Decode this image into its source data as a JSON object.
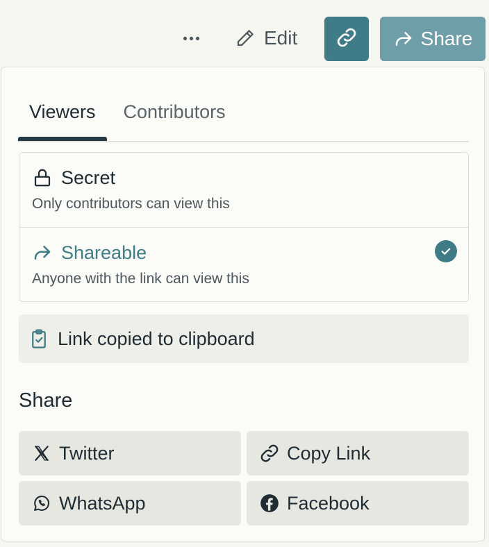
{
  "toolbar": {
    "more_icon": "more-horizontal-icon",
    "edit_label": "Edit",
    "edit_icon": "pencil-icon",
    "link_icon": "link-icon",
    "share_label": "Share",
    "share_icon": "share-arrow-icon"
  },
  "panel": {
    "tabs": [
      {
        "label": "Viewers",
        "active": true
      },
      {
        "label": "Contributors",
        "active": false
      }
    ],
    "options": [
      {
        "title": "Secret",
        "description": "Only contributors can view this",
        "icon": "lock-icon",
        "selected": false
      },
      {
        "title": "Shareable",
        "description": "Anyone with the link can view this",
        "icon": "share-arrow-icon",
        "selected": true
      }
    ],
    "copied_message": "Link copied to clipboard",
    "copied_icon": "clipboard-check-icon",
    "share_heading": "Share",
    "share_targets": [
      {
        "label": "Twitter",
        "icon": "x-logo-icon"
      },
      {
        "label": "Copy Link",
        "icon": "link-icon"
      },
      {
        "label": "WhatsApp",
        "icon": "whatsapp-icon"
      },
      {
        "label": "Facebook",
        "icon": "facebook-icon"
      }
    ]
  },
  "colors": {
    "accent": "#3f7c88",
    "share_button": "#6e9ea7",
    "text": "#1f2c33",
    "page_bg": "#f6f6f1"
  }
}
